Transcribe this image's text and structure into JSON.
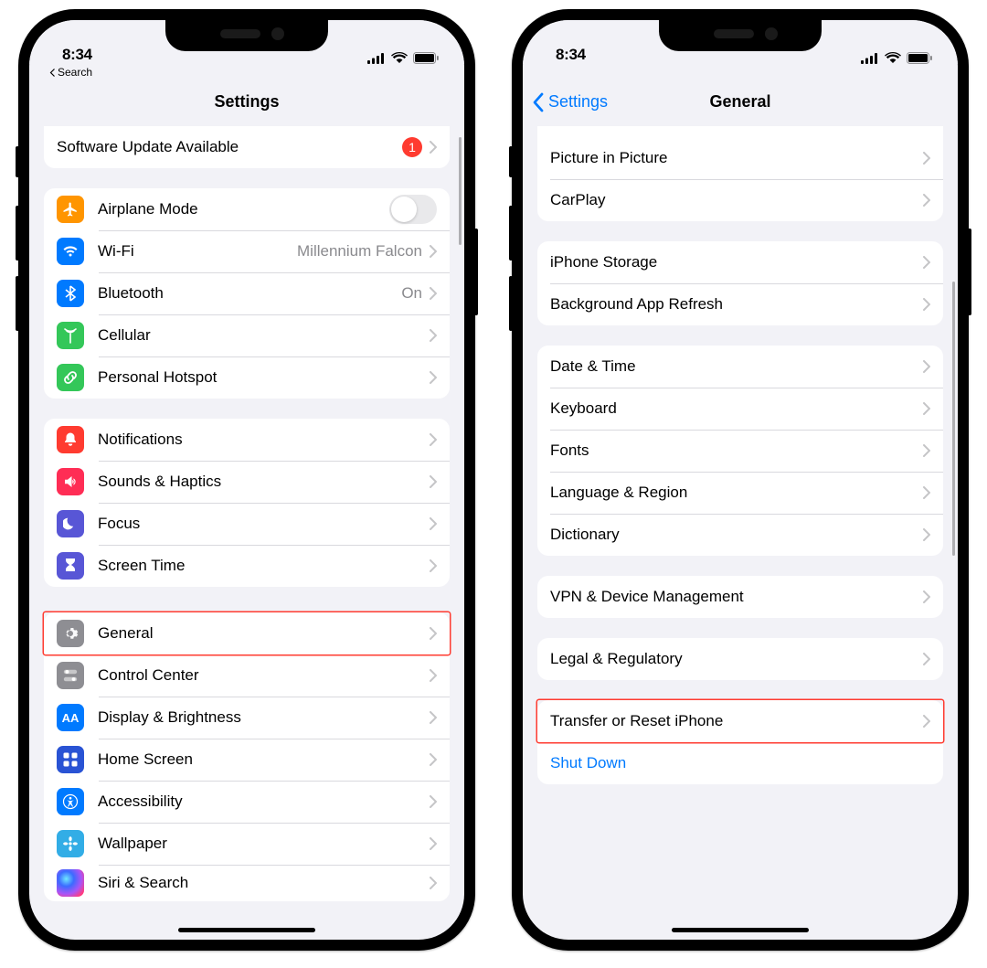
{
  "status_time": "8:34",
  "breadcrumb_back": "Search",
  "left": {
    "title": "Settings",
    "software_update": {
      "label": "Software Update Available",
      "badge": "1"
    },
    "group1": [
      {
        "label": "Airplane Mode",
        "icon": "airplane",
        "color": "bg-orange",
        "control": "toggle"
      },
      {
        "label": "Wi-Fi",
        "icon": "wifi",
        "color": "bg-blue",
        "value": "Millennium Falcon"
      },
      {
        "label": "Bluetooth",
        "icon": "bluetooth",
        "color": "bg-blue",
        "value": "On"
      },
      {
        "label": "Cellular",
        "icon": "antenna",
        "color": "bg-green"
      },
      {
        "label": "Personal Hotspot",
        "icon": "link",
        "color": "bg-green"
      }
    ],
    "group2": [
      {
        "label": "Notifications",
        "icon": "bell",
        "color": "bg-red"
      },
      {
        "label": "Sounds & Haptics",
        "icon": "speaker",
        "color": "bg-pink"
      },
      {
        "label": "Focus",
        "icon": "moon",
        "color": "bg-indigo"
      },
      {
        "label": "Screen Time",
        "icon": "hourglass",
        "color": "bg-indigo"
      }
    ],
    "group3": [
      {
        "label": "General",
        "icon": "gear",
        "color": "bg-gray",
        "highlight": true
      },
      {
        "label": "Control Center",
        "icon": "switches",
        "color": "bg-gray"
      },
      {
        "label": "Display & Brightness",
        "icon": "aa",
        "color": "bg-blue"
      },
      {
        "label": "Home Screen",
        "icon": "grid",
        "color": "bg-bluegrid"
      },
      {
        "label": "Accessibility",
        "icon": "accessibility",
        "color": "bg-blue"
      },
      {
        "label": "Wallpaper",
        "icon": "flower",
        "color": "bg-cyan"
      },
      {
        "label": "Siri & Search",
        "icon": "siri",
        "color": "siri-bg"
      }
    ]
  },
  "right": {
    "back": "Settings",
    "title": "General",
    "group1": [
      {
        "label": "Picture in Picture"
      },
      {
        "label": "CarPlay"
      }
    ],
    "group2": [
      {
        "label": "iPhone Storage"
      },
      {
        "label": "Background App Refresh"
      }
    ],
    "group3": [
      {
        "label": "Date & Time"
      },
      {
        "label": "Keyboard"
      },
      {
        "label": "Fonts"
      },
      {
        "label": "Language & Region"
      },
      {
        "label": "Dictionary"
      }
    ],
    "group4": [
      {
        "label": "VPN & Device Management"
      }
    ],
    "group5": [
      {
        "label": "Legal & Regulatory"
      }
    ],
    "group6": [
      {
        "label": "Transfer or Reset iPhone",
        "highlight": true
      },
      {
        "label": "Shut Down",
        "link": true
      }
    ]
  }
}
